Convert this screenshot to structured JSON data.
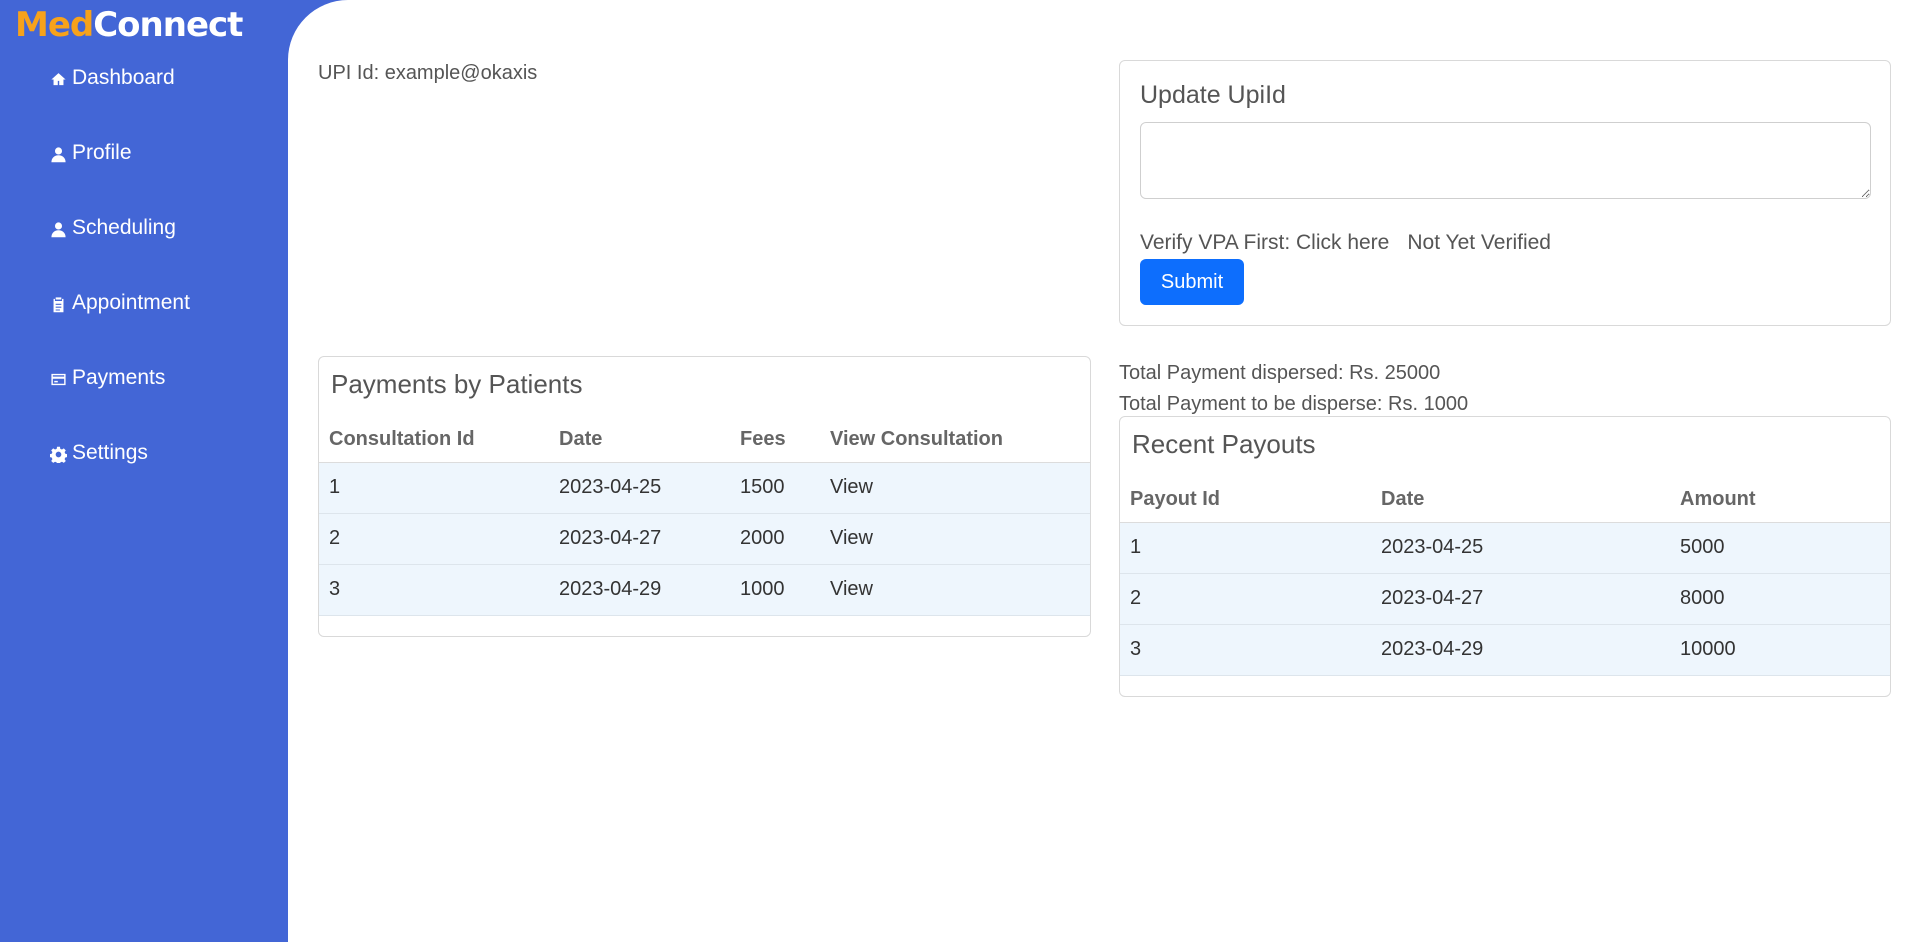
{
  "logo": {
    "part1": "Med",
    "part2": "Connect"
  },
  "sidebar": {
    "items": [
      {
        "label": "Dashboard",
        "icon": "home-icon"
      },
      {
        "label": "Profile",
        "icon": "user-icon"
      },
      {
        "label": "Scheduling",
        "icon": "user-icon"
      },
      {
        "label": "Appointment",
        "icon": "clipboard-icon"
      },
      {
        "label": "Payments",
        "icon": "credit-card-icon"
      },
      {
        "label": "Settings",
        "icon": "gear-icon"
      }
    ]
  },
  "upi": {
    "text": "UPI Id: example@okaxis"
  },
  "update_upi": {
    "title": "Update UpiId",
    "textarea_value": "",
    "verify_text": "Verify VPA First: Click here",
    "status": "Not Yet Verified",
    "submit_label": "Submit"
  },
  "totals": {
    "dispersed": "Total Payment dispersed: Rs. 25000",
    "to_disperse": "Total Payment to be disperse: Rs. 1000"
  },
  "patients": {
    "title": "Payments by Patients",
    "headers": [
      "Consultation Id",
      "Date",
      "Fees",
      "View Consultation"
    ],
    "rows": [
      [
        "1",
        "2023-04-25",
        "1500",
        "View"
      ],
      [
        "2",
        "2023-04-27",
        "2000",
        "View"
      ],
      [
        "3",
        "2023-04-29",
        "1000",
        "View"
      ]
    ]
  },
  "payouts": {
    "title": "Recent Payouts",
    "headers": [
      "Payout Id",
      "Date",
      "Amount"
    ],
    "rows": [
      [
        "1",
        "2023-04-25",
        "5000"
      ],
      [
        "2",
        "2023-04-27",
        "8000"
      ],
      [
        "3",
        "2023-04-29",
        "10000"
      ]
    ]
  },
  "colors": {
    "sidebar_bg": "#4366d6",
    "logo_accent": "#f7a21b",
    "primary_button": "#0d6efd",
    "row_bg": "#eef6fd"
  }
}
